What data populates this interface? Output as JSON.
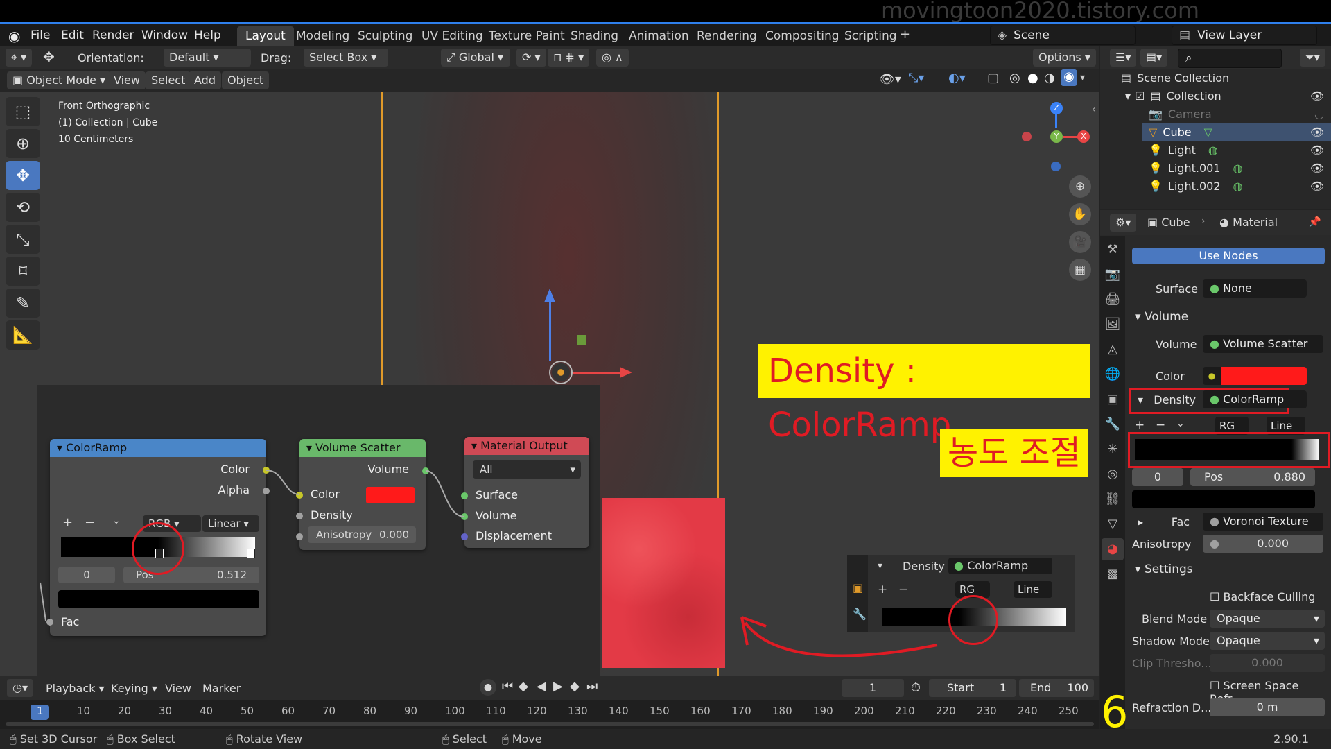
{
  "watermark": "movingtoon2020.tistory.com",
  "menu": [
    "File",
    "Edit",
    "Render",
    "Window",
    "Help"
  ],
  "workspaces": [
    "Layout",
    "Modeling",
    "Sculpting",
    "UV Editing",
    "Texture Paint",
    "Shading",
    "Animation",
    "Rendering",
    "Compositing",
    "Scripting"
  ],
  "active_workspace": "Layout",
  "scene": "Scene",
  "view_layer": "View Layer",
  "toolbar": {
    "orientation_label": "Orientation:",
    "orientation_value": "Default",
    "drag_label": "Drag:",
    "drag_value": "Select Box",
    "transform": "Global",
    "options": "Options"
  },
  "viewport_header": {
    "mode": "Object Mode",
    "menus": [
      "View",
      "Select",
      "Add",
      "Object"
    ]
  },
  "viewport_info": {
    "line1": "Front Orthographic",
    "line2": "(1) Collection | Cube",
    "line3": "10 Centimeters"
  },
  "gizmo": {
    "z": "Z",
    "y": "Y",
    "x": "X"
  },
  "nodes": {
    "colorramp": {
      "title": "ColorRamp",
      "out_color": "Color",
      "out_alpha": "Alpha",
      "mode": "RGB",
      "interp": "Linear",
      "index": "0",
      "pos_label": "Pos",
      "pos_value": "0.512",
      "in_fac": "Fac"
    },
    "scatter": {
      "title": "Volume Scatter",
      "out_volume": "Volume",
      "in_color": "Color",
      "in_density": "Density",
      "in_aniso": "Anisotropy",
      "aniso_value": "0.000"
    },
    "output": {
      "title": "Material Output",
      "target": "All",
      "in_surface": "Surface",
      "in_volume": "Volume",
      "in_displacement": "Displacement"
    }
  },
  "inset": {
    "density_label": "Density",
    "ramp_label": "ColorRamp",
    "mode": "RG",
    "interp": "Line"
  },
  "annotations": {
    "density": "Density : ColorRamp",
    "korean": "농도 조절",
    "step": "6"
  },
  "outliner": {
    "title": "Scene Collection",
    "items": [
      {
        "label": "Collection"
      },
      {
        "label": "Camera"
      },
      {
        "label": "Cube"
      },
      {
        "label": "Light"
      },
      {
        "label": "Light.001"
      },
      {
        "label": "Light.002"
      }
    ]
  },
  "properties": {
    "breadcrumb_object": "Cube",
    "breadcrumb_material": "Material",
    "use_nodes": "Use Nodes",
    "surface_label": "Surface",
    "surface_value": "None",
    "volume_section": "Volume",
    "volume_label": "Volume",
    "volume_value": "Volume Scatter",
    "color_label": "Color",
    "density_label": "Density",
    "density_value": "ColorRamp",
    "ramp_mode": "RG",
    "ramp_interp": "Line",
    "ramp_index": "0",
    "ramp_pos_label": "Pos",
    "ramp_pos_value": "0.880",
    "fac_label": "Fac",
    "fac_value": "Voronoi Texture",
    "aniso_label": "Anisotropy",
    "aniso_value": "0.000",
    "settings_section": "Settings",
    "backface": "Backface Culling",
    "blend_label": "Blend Mode",
    "blend_value": "Opaque",
    "shadow_label": "Shadow Mode",
    "shadow_value": "Opaque",
    "clip_label": "Clip Thresho...",
    "clip_value": "0.000",
    "ssr": "Screen Space Refr...",
    "refr_label": "Refraction D...",
    "refr_value": "0 m"
  },
  "timeline": {
    "menus": [
      "Playback",
      "Keying",
      "View",
      "Marker"
    ],
    "current": "1",
    "start_label": "Start",
    "start": "1",
    "end_label": "End",
    "end": "100",
    "ticks": [
      "1",
      "10",
      "20",
      "30",
      "40",
      "50",
      "60",
      "70",
      "80",
      "90",
      "100",
      "110",
      "120",
      "130",
      "140",
      "150",
      "160",
      "170",
      "180",
      "190",
      "200",
      "210",
      "220",
      "230",
      "240",
      "250"
    ]
  },
  "status": {
    "a": "Set 3D Cursor",
    "b": "Box Select",
    "c": "Rotate View",
    "d": "Select",
    "e": "Move",
    "version": "2.90.1"
  },
  "colors": {
    "accent": "#4a78c0",
    "red": "#e01b24",
    "annotation_bg": "#fff200",
    "scatter_color": "#ff1a1a"
  }
}
